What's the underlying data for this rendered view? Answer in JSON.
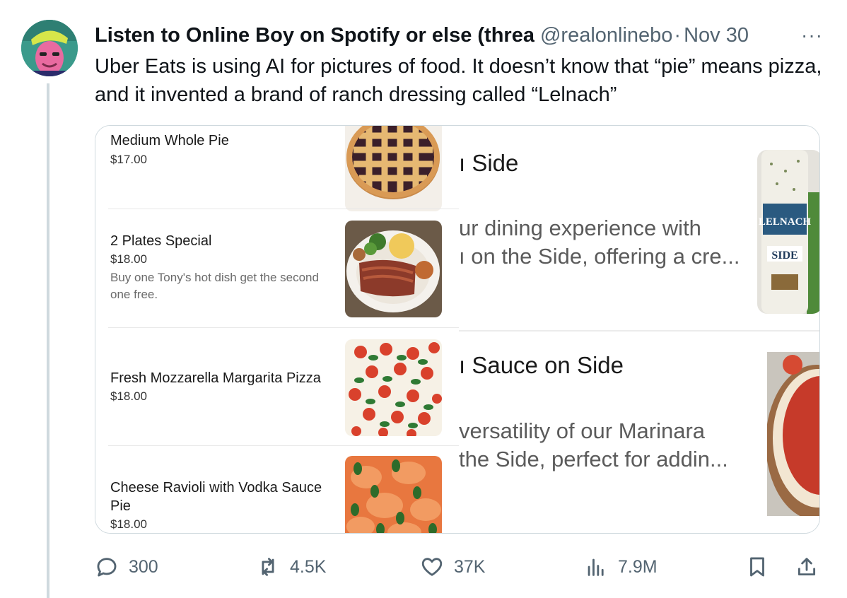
{
  "tweet": {
    "display_name": "Listen to Online Boy on Spotify or else (threa",
    "handle": "@realonlinebo",
    "separator": "·",
    "date": "Nov 30",
    "more_label": "···",
    "text": "Uber Eats is using AI for pictures of food. It doesn’t know that “pie” means pizza, and it invented a brand of ranch dressing called “Lelnach”"
  },
  "menu_items": [
    {
      "name": "Medium Whole Pie",
      "price": "$17.00",
      "description": "",
      "image": "lattice-pie"
    },
    {
      "name": "2 Plates Special",
      "price": "$18.00",
      "description": "Buy one Tony's hot dish get the second one free.",
      "image": "plate-meatloaf"
    },
    {
      "name": "Fresh Mozzarella Margarita Pizza",
      "price": "$18.00",
      "description": "",
      "image": "margherita-pizza"
    },
    {
      "name": "Cheese Ravioli with Vodka Sauce Pie",
      "price": "$18.00",
      "description": "",
      "image": "ravioli-vodka"
    }
  ],
  "side_items": [
    {
      "title": "ı Side",
      "line1": "ur dining experience with",
      "line2": "ı on the Side, offering a cre...",
      "image": "lelnach-bottle"
    },
    {
      "title": "ı Sauce on Side",
      "line1": "versatility of our Marinara",
      "line2": "the Side, perfect for addin...",
      "image": "marinara-sauce"
    }
  ],
  "bottle_label": {
    "brand": "LELNACH",
    "word": "SIDE"
  },
  "actions": {
    "replies": "300",
    "reposts": "4.5K",
    "likes": "37K",
    "views": "7.9M"
  },
  "colors": {
    "text_primary": "#0f1419",
    "text_secondary": "#536471",
    "border": "#cfd9de"
  }
}
